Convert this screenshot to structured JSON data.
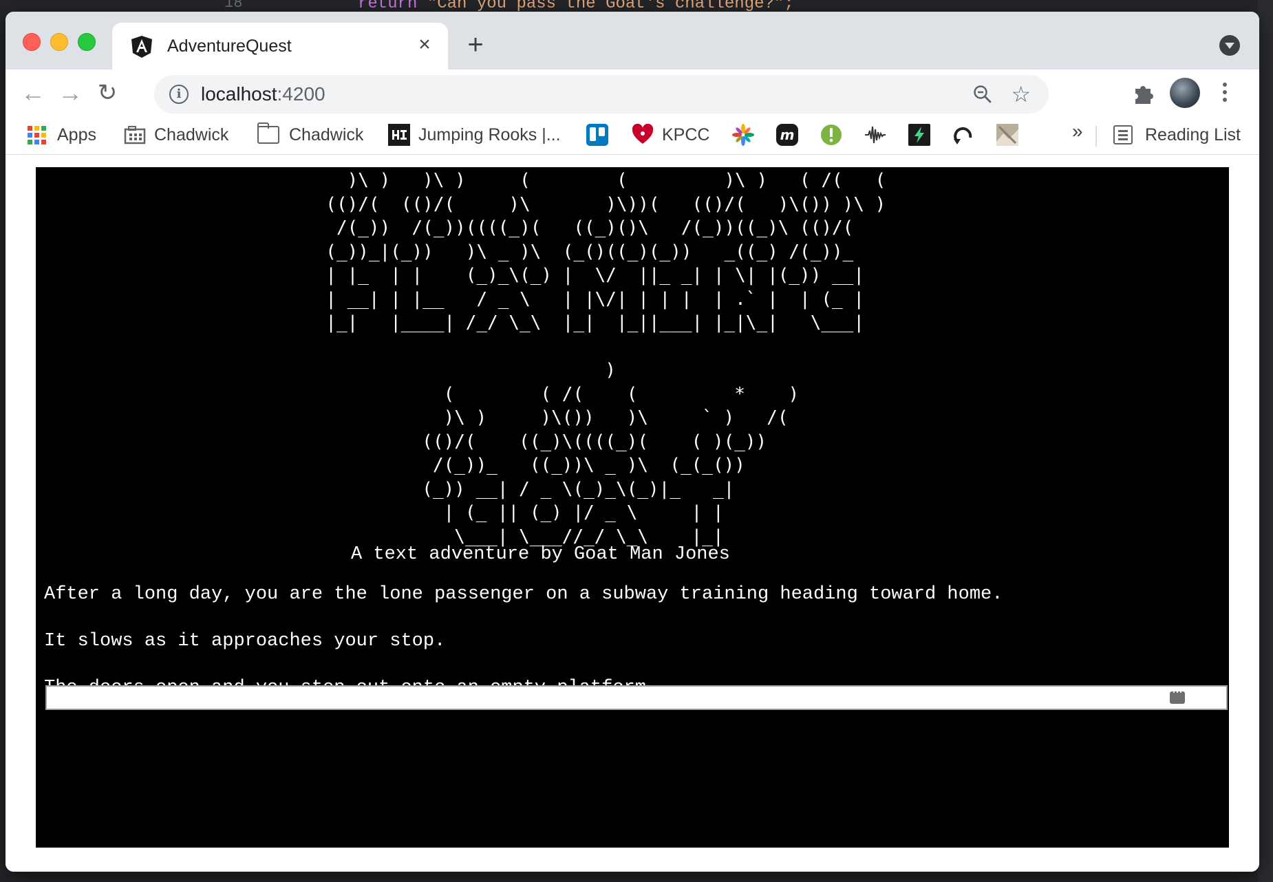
{
  "background_editor": {
    "line_number": "18",
    "code_keyword": "return",
    "code_string": "\"Can you pass the Goat's challenge?\";"
  },
  "browser": {
    "tab": {
      "title": "AdventureQuest",
      "favicon": "angular-icon",
      "close_icon": "×"
    },
    "new_tab_label": "+",
    "address_bar": {
      "host": "localhost",
      "port": ":4200"
    },
    "bookmarks": [
      {
        "label": "Apps",
        "icon": "apps-grid-icon"
      },
      {
        "label": "Chadwick",
        "icon": "building-icon"
      },
      {
        "label": "Chadwick",
        "icon": "folder-icon"
      },
      {
        "label": "Jumping Rooks |...",
        "icon": "hi-icon"
      },
      {
        "label": "",
        "icon": "trello-icon"
      },
      {
        "label": "KPCC",
        "icon": "iheart-icon"
      },
      {
        "label": "",
        "icon": "pinwheel-icon"
      },
      {
        "label": "",
        "icon": "m-icon"
      },
      {
        "label": "",
        "icon": "exclamation-icon"
      },
      {
        "label": "",
        "icon": "waveform-icon"
      },
      {
        "label": "",
        "icon": "bolt-icon"
      },
      {
        "label": "",
        "icon": "arc-icon"
      },
      {
        "label": "",
        "icon": "thumbnail-icon"
      }
    ],
    "overflow_label": "»",
    "reading_list_label": "Reading List",
    "colors": {
      "tabstrip": "#dee1e6",
      "terminal_bg": "#000000",
      "terminal_text": "#ffffff"
    }
  },
  "game": {
    "title_art": "    )\\ )   )\\ )     (        (         )\\ )   ( /(   (\n  (()/(  (()/(     )\\       )\\))(   (()/(   )\\()) )\\ )\n   /(_))  /(_))((((_)(   ((_)()\\   /(_))((_)\\ (()/(\n  (_))_|(_))   )\\ _ )\\  (_()((_)(_))   _((_) /(_))_\n  | |_  | |    (_)_\\(_) |  \\/  ||_ _| | \\| |(_)) __|\n  | __| | |__   / _ \\   | |\\/| | | |  | .` |  | (_ |\n  |_|   |____| /_/ \\_\\  |_|  |_||___| |_|\\_|   \\___|",
    "goat_art": "                   )\n    (        ( /(    (         *    )\n    )\\ )     )\\())   )\\     ` )   /(\n  (()/(    ((_)\\((((_)(    ( )(_))\n   /(_))_   ((_))\\ _ )\\  (_(_())\n  (_)) __| / _ \\(_)_\\(_)|_   _|\n    | (_ || (_) |/ _ \\     | |\n     \\___| \\___//_/ \\_\\    |_|",
    "byline": "A text adventure by Goat Man Jones",
    "lines": [
      "After a long day, you are the lone passenger on a subway training heading toward home.",
      "It slows as it approaches your stop.",
      "The doors open and you step out onto an empty platform."
    ],
    "command_input": {
      "value": "",
      "placeholder": ""
    }
  }
}
